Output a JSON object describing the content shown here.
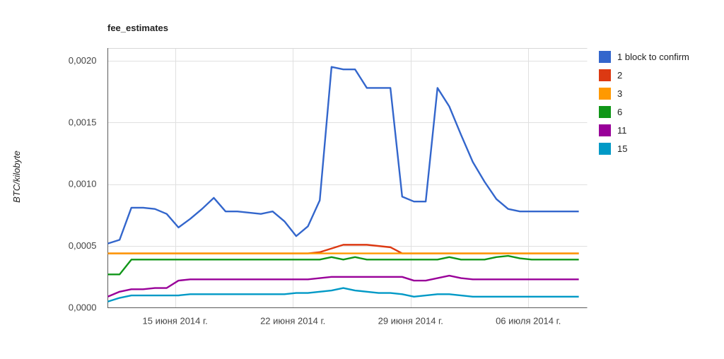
{
  "chart_data": {
    "type": "line",
    "title": "fee_estimates",
    "xlabel": "",
    "ylabel": "BTC/kilobyte",
    "ylim": [
      0.0,
      0.0021
    ],
    "xlim": [
      0,
      28.5
    ],
    "grid": true,
    "legend_position": "right",
    "y_ticks": [
      {
        "value": 0.0,
        "label": "0,0000"
      },
      {
        "value": 0.0005,
        "label": "0,0005"
      },
      {
        "value": 0.001,
        "label": "0,0010"
      },
      {
        "value": 0.0015,
        "label": "0,0015"
      },
      {
        "value": 0.002,
        "label": "0,0020"
      }
    ],
    "x_ticks": [
      {
        "value": 4,
        "label": "15 июня 2014 г."
      },
      {
        "value": 11,
        "label": "22 июня 2014 г."
      },
      {
        "value": 18,
        "label": "29 июня 2014 г."
      },
      {
        "value": 25,
        "label": "06 июля 2014 г."
      }
    ],
    "x": [
      0,
      0.7,
      1.4,
      2.1,
      2.8,
      3.5,
      4.2,
      4.9,
      5.6,
      6.3,
      7.0,
      7.7,
      8.4,
      9.1,
      9.8,
      10.5,
      11.2,
      11.9,
      12.6,
      13.3,
      14.0,
      14.7,
      15.4,
      16.1,
      16.8,
      17.5,
      18.2,
      18.9,
      19.6,
      20.3,
      21.0,
      21.7,
      22.4,
      23.1,
      23.8,
      24.5,
      25.2,
      25.9,
      26.6,
      27.3,
      28.0
    ],
    "series": [
      {
        "name": "1 block to confirm",
        "color": "#3366cc",
        "values": [
          0.00052,
          0.00055,
          0.00081,
          0.00081,
          0.0008,
          0.00076,
          0.00065,
          0.00072,
          0.0008,
          0.00089,
          0.00078,
          0.00078,
          0.00077,
          0.00076,
          0.00078,
          0.0007,
          0.00058,
          0.00066,
          0.00087,
          0.00195,
          0.00193,
          0.00193,
          0.00178,
          0.00178,
          0.00178,
          0.0009,
          0.00086,
          0.00086,
          0.00178,
          0.00163,
          0.0014,
          0.00118,
          0.00102,
          0.00088,
          0.0008,
          0.00078,
          0.00078,
          0.00078,
          0.00078,
          0.00078,
          0.00078
        ]
      },
      {
        "name": "2",
        "color": "#dc3912",
        "values": [
          0.00044,
          0.00044,
          0.00044,
          0.00044,
          0.00044,
          0.00044,
          0.00044,
          0.00044,
          0.00044,
          0.00044,
          0.00044,
          0.00044,
          0.00044,
          0.00044,
          0.00044,
          0.00044,
          0.00044,
          0.00044,
          0.00045,
          0.00048,
          0.00051,
          0.00051,
          0.00051,
          0.0005,
          0.00049,
          0.00044,
          0.00044,
          0.00044,
          0.00044,
          0.00044,
          0.00044,
          0.00044,
          0.00044,
          0.00044,
          0.00044,
          0.00044,
          0.00044,
          0.00044,
          0.00044,
          0.00044,
          0.00044
        ]
      },
      {
        "name": "3",
        "color": "#ff9900",
        "values": [
          0.00044,
          0.00044,
          0.00044,
          0.00044,
          0.00044,
          0.00044,
          0.00044,
          0.00044,
          0.00044,
          0.00044,
          0.00044,
          0.00044,
          0.00044,
          0.00044,
          0.00044,
          0.00044,
          0.00044,
          0.00044,
          0.00044,
          0.00044,
          0.00044,
          0.00044,
          0.00044,
          0.00044,
          0.00044,
          0.00044,
          0.00044,
          0.00044,
          0.00044,
          0.00044,
          0.00044,
          0.00044,
          0.00044,
          0.00044,
          0.00044,
          0.00044,
          0.00044,
          0.00044,
          0.00044,
          0.00044,
          0.00044
        ]
      },
      {
        "name": "6",
        "color": "#109618",
        "values": [
          0.00027,
          0.00027,
          0.00039,
          0.00039,
          0.00039,
          0.00039,
          0.00039,
          0.00039,
          0.00039,
          0.00039,
          0.00039,
          0.00039,
          0.00039,
          0.00039,
          0.00039,
          0.00039,
          0.00039,
          0.00039,
          0.00039,
          0.00041,
          0.00039,
          0.00041,
          0.00039,
          0.00039,
          0.00039,
          0.00039,
          0.00039,
          0.00039,
          0.00039,
          0.00041,
          0.00039,
          0.00039,
          0.00039,
          0.00041,
          0.00042,
          0.0004,
          0.00039,
          0.00039,
          0.00039,
          0.00039,
          0.00039
        ]
      },
      {
        "name": "11",
        "color": "#990099",
        "values": [
          9e-05,
          0.00013,
          0.00015,
          0.00015,
          0.00016,
          0.00016,
          0.00022,
          0.00023,
          0.00023,
          0.00023,
          0.00023,
          0.00023,
          0.00023,
          0.00023,
          0.00023,
          0.00023,
          0.00023,
          0.00023,
          0.00024,
          0.00025,
          0.00025,
          0.00025,
          0.00025,
          0.00025,
          0.00025,
          0.00025,
          0.00022,
          0.00022,
          0.00024,
          0.00026,
          0.00024,
          0.00023,
          0.00023,
          0.00023,
          0.00023,
          0.00023,
          0.00023,
          0.00023,
          0.00023,
          0.00023,
          0.00023
        ]
      },
      {
        "name": "15",
        "color": "#0099c6",
        "values": [
          5e-05,
          8e-05,
          0.0001,
          0.0001,
          0.0001,
          0.0001,
          0.0001,
          0.00011,
          0.00011,
          0.00011,
          0.00011,
          0.00011,
          0.00011,
          0.00011,
          0.00011,
          0.00011,
          0.00012,
          0.00012,
          0.00013,
          0.00014,
          0.00016,
          0.00014,
          0.00013,
          0.00012,
          0.00012,
          0.00011,
          9e-05,
          0.0001,
          0.00011,
          0.00011,
          0.0001,
          9e-05,
          9e-05,
          9e-05,
          9e-05,
          9e-05,
          9e-05,
          9e-05,
          9e-05,
          9e-05,
          9e-05
        ]
      }
    ]
  },
  "legend": {
    "items": [
      {
        "label": "1 block to confirm",
        "color": "#3366cc"
      },
      {
        "label": "2",
        "color": "#dc3912"
      },
      {
        "label": "3",
        "color": "#ff9900"
      },
      {
        "label": "6",
        "color": "#109618"
      },
      {
        "label": "11",
        "color": "#990099"
      },
      {
        "label": "15",
        "color": "#0099c6"
      }
    ]
  }
}
